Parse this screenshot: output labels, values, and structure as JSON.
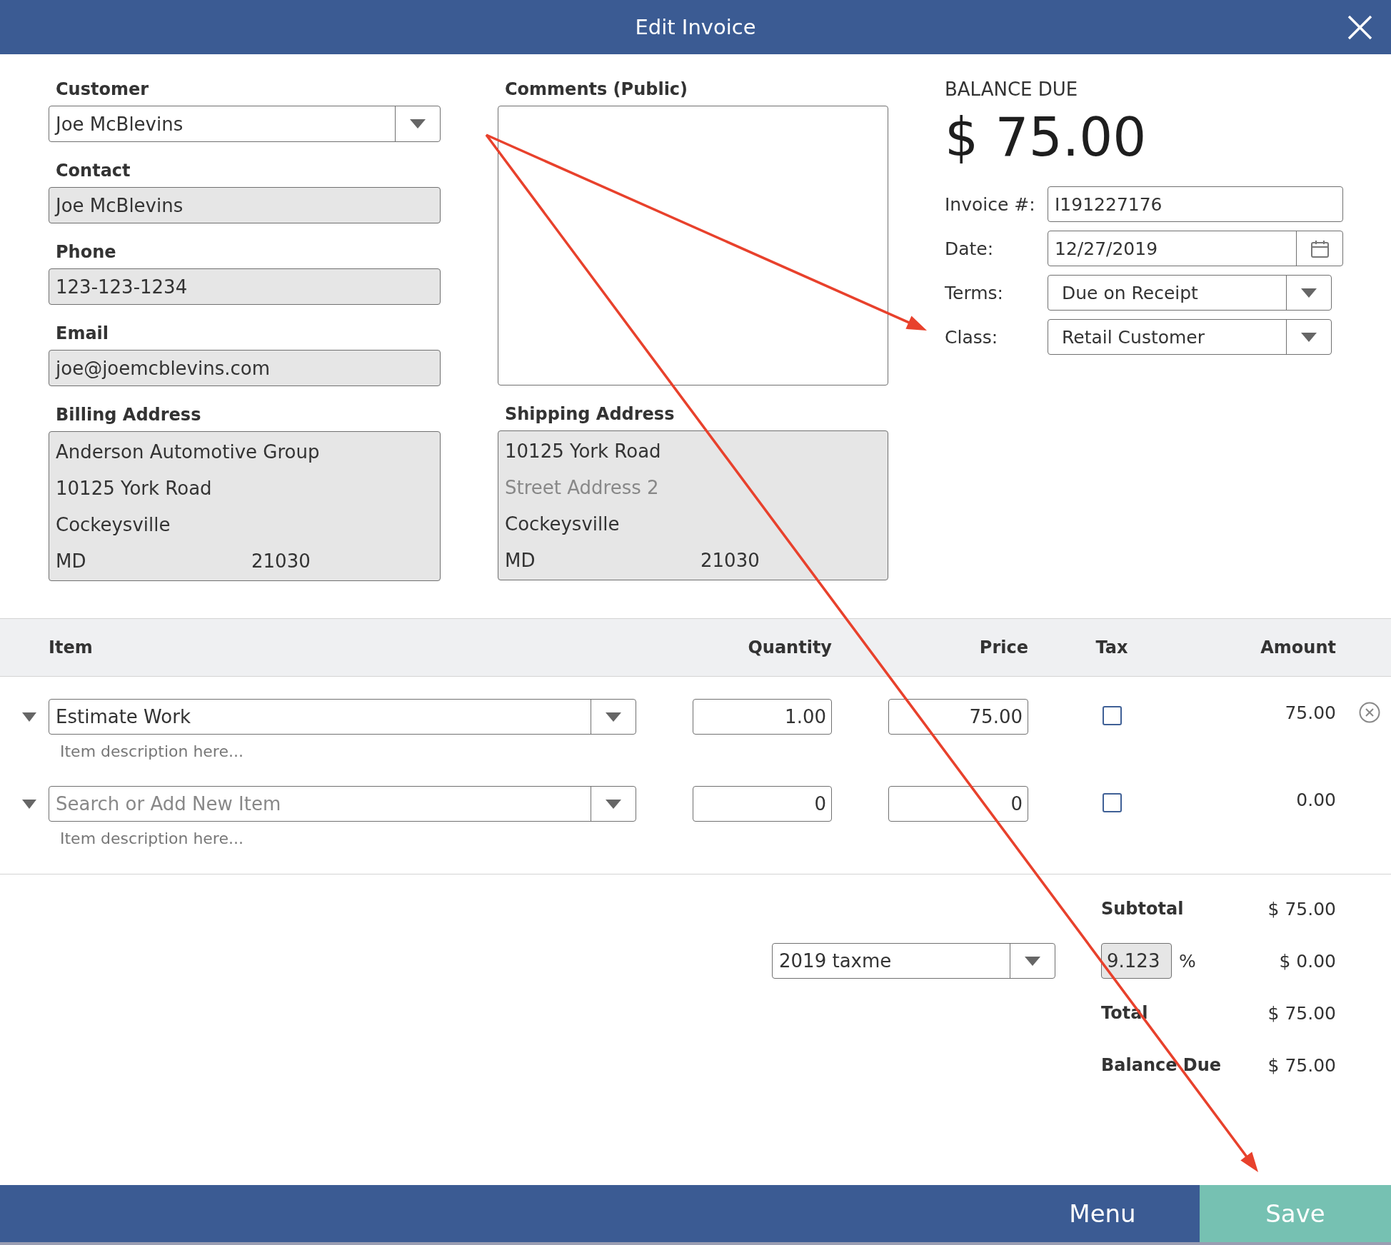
{
  "window": {
    "title": "Edit Invoice"
  },
  "customer_info": [
    {
      "kind": "dropdown",
      "label": "Customer",
      "value": "Joe McBlevins",
      "readonly": false
    },
    {
      "kind": "text",
      "label": "Contact",
      "value": "Joe McBlevins",
      "readonly": true
    },
    {
      "kind": "text",
      "label": "Phone",
      "value": "123-123-1234",
      "readonly": true
    },
    {
      "kind": "text",
      "label": "Email",
      "value": "joe@joemcblevins.com",
      "readonly": true
    }
  ],
  "billing_address": {
    "label": "Billing Address",
    "readonly": true,
    "lines": [
      {
        "value": "Anderson Automotive Group"
      },
      {
        "value": "10125 York Road"
      },
      {
        "value": "Cockeysville"
      }
    ],
    "state": "MD",
    "zip": "21030"
  },
  "comments": {
    "label": "Comments (Public)"
  },
  "shipping_address": {
    "label": "Shipping Address",
    "readonly": true,
    "lines": [
      {
        "value": "10125 York Road"
      },
      {
        "placeholder": "Street Address 2"
      },
      {
        "value": "Cockeysville"
      }
    ],
    "state": "MD",
    "zip": "21030"
  },
  "balance": {
    "label": "BALANCE DUE",
    "amount": "$ 75.00"
  },
  "invoice_fields": [
    {
      "kind": "text",
      "label": "Invoice #:",
      "value": "I191227176"
    },
    {
      "kind": "date",
      "label": "Date:",
      "value": "12/27/2019"
    },
    {
      "kind": "dropdown",
      "label": "Terms:",
      "value": "Due on Receipt"
    },
    {
      "kind": "dropdown",
      "label": "Class:",
      "value": "Retail Customer"
    }
  ],
  "table": {
    "columns": [
      "Item",
      "Quantity",
      "Price",
      "Tax",
      "Amount"
    ],
    "rows": [
      {
        "item": "Estimate Work",
        "description_placeholder": "Item description here...",
        "quantity": "1.00",
        "price": "75.00",
        "taxable": false,
        "amount": "75.00",
        "removable": true
      },
      {
        "item_placeholder": "Search or Add New Item",
        "description_placeholder": "Item description here...",
        "quantity": "0",
        "price": "0",
        "taxable": false,
        "amount": "0.00",
        "removable": false
      }
    ]
  },
  "totals": [
    {
      "kind": "line",
      "label": "Subtotal",
      "value": "$ 75.00"
    },
    {
      "kind": "tax",
      "tax_name": "2019 taxme",
      "rate": "9.123",
      "readonly": true,
      "unit": "%",
      "value": "$ 0.00"
    },
    {
      "kind": "line",
      "label": "Total",
      "value": "$ 75.00"
    },
    {
      "kind": "line",
      "label": "Balance Due",
      "value": "$ 75.00"
    }
  ],
  "footer": {
    "buttons": [
      {
        "label": "Menu",
        "kind": "secondary"
      },
      {
        "label": "Save",
        "kind": "primary"
      }
    ]
  },
  "annotation_arrows": [
    {
      "kind": "arrow"
    },
    {
      "kind": "arrow"
    }
  ]
}
